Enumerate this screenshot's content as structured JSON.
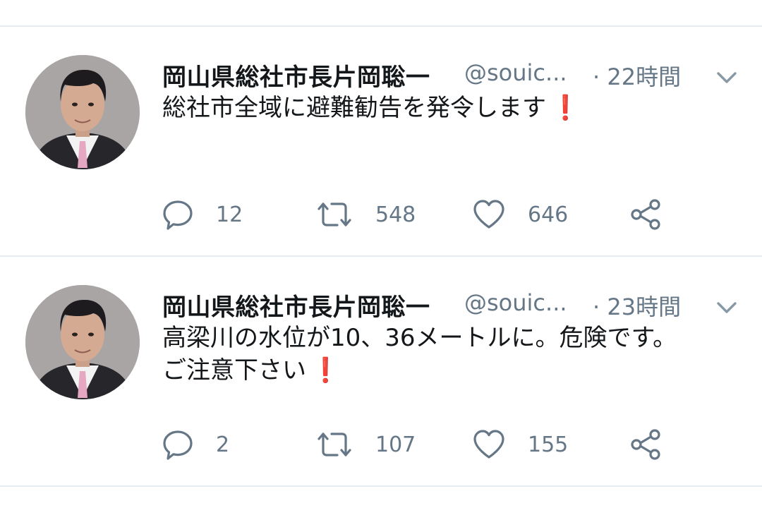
{
  "feed": {
    "tweets": [
      {
        "display_name": "岡山県総社市長片岡聡一",
        "handle": "@souic...",
        "time": "· 22時間",
        "text": "総社市全域に避難勧告を発令します",
        "emoji": "❗",
        "replies": "12",
        "retweets": "548",
        "likes": "646"
      },
      {
        "display_name": "岡山県総社市長片岡聡一",
        "handle": "@souic...",
        "time": "· 23時間",
        "text": "高梁川の水位が10、36メートルに。危険です。\nご注意下さい",
        "emoji": "❗",
        "replies": "2",
        "retweets": "107",
        "likes": "155"
      }
    ]
  },
  "icons": {
    "reply": "speech-bubble-icon",
    "retweet": "retweet-arrows-icon",
    "like": "heart-outline-icon",
    "share": "share-nodes-icon",
    "menu": "chevron-down-icon"
  },
  "colors": {
    "text_primary": "#14171a",
    "text_secondary": "#657786",
    "divider": "#e6ecf0",
    "emoji_red": "#d0021b"
  }
}
